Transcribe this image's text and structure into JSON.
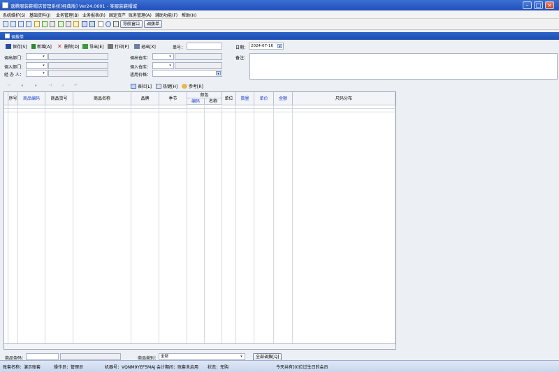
{
  "window": {
    "title": "速腾服装鞋帽店管理系统[经典版] Ver24.0601 - 某服装鞋帽城",
    "minimize": "–",
    "maximize": "□",
    "close": "×"
  },
  "menu": [
    "系统维护(S)",
    "基础资料(J)",
    "业务管理(B)",
    "业务报表(R)",
    "固定资产",
    "账务管理(A)",
    "辅助功能(F)",
    "帮助(H)"
  ],
  "icon_toolbar": {
    "icons": [
      "window-icon",
      "window-icon",
      "window-icon",
      "window-icon",
      "document-icon",
      "arrow-icon",
      "tools-icon",
      "arrow-icon",
      "tools-icon",
      "folder-icon",
      "save-icon",
      "save-icon",
      "document-icon",
      "help-icon",
      "exit-icon"
    ],
    "nav_window": "导航窗口",
    "transfer_order": "调拨单"
  },
  "document": {
    "title": "调拨单"
  },
  "actions": {
    "save": "保存[S]",
    "add": "新增[A]",
    "delete": "删除[D]",
    "export": "导出[E]",
    "print": "打印[P]",
    "exit": "退出[X]",
    "order_no_label": "单号：",
    "order_no": "",
    "date_label": "日期：",
    "date": "2024-07-16"
  },
  "form": {
    "out_dept_label": "调出部门：",
    "in_dept_label": "调入部门：",
    "handler_label": "经 办 人：",
    "out_warehouse_label": "调出仓库：",
    "in_warehouse_label": "调入仓库：",
    "price_label": "适用价格：",
    "remark_label": "备注：",
    "out_dept": "",
    "in_dept": "",
    "handler": "",
    "out_warehouse": "",
    "in_warehouse": "",
    "price": ""
  },
  "grid_toolbar": {
    "nav_icons": [
      "first-icon",
      "prev-icon",
      "next-icon",
      "last-icon",
      "check-icon",
      "undo-icon"
    ],
    "columns_btn": "表栏[L]",
    "hotkey_btn": "热键[H]",
    "reference_btn": "参考[R]"
  },
  "grid": {
    "headers": {
      "seq": "序号",
      "product_code": "商品编码",
      "article_no": "商品货号",
      "product_name": "商品名称",
      "brand": "品牌",
      "season": "季节",
      "color": "颜色",
      "color_code": "编码",
      "color_name": "名称",
      "unit_col": "单位",
      "quantity": "数量",
      "unit_price": "单价",
      "amount": "金额",
      "size_distribution": "尺码分布"
    }
  },
  "bottom": {
    "barcode_label": "商品条码：",
    "barcode": "",
    "category_label": "商品类别：",
    "category": "全部",
    "transfer_all_btn": "全部调拨[Q]"
  },
  "status": {
    "account": "账套名称：演示账套",
    "operator": "操作员：管理员",
    "machine": "机器号：VQNM9YEF5MAJ",
    "period": "会计期间：账套未启用",
    "state": "状态：无购",
    "birthday": "今天共有[0]位过生日的会员"
  },
  "colors": {
    "title_blue": "#1f4fb8",
    "header_blue": "#1d4cb1",
    "link_blue": "#1b3fd3"
  }
}
